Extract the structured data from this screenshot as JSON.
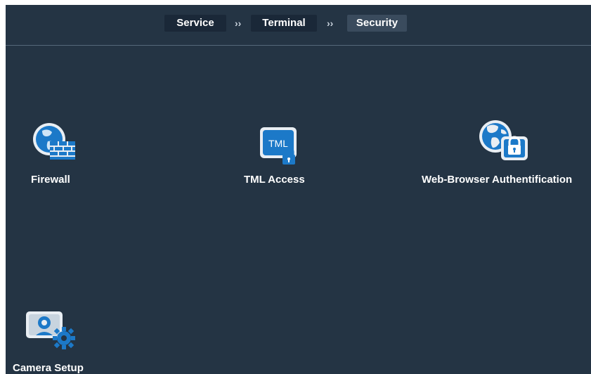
{
  "breadcrumb": {
    "items": [
      {
        "label": "Service"
      },
      {
        "label": "Terminal"
      },
      {
        "label": "Security"
      }
    ],
    "separator": "››",
    "active_index": 2
  },
  "tiles": [
    {
      "label": "Firewall",
      "icon": "firewall-icon"
    },
    {
      "label": "TML Access",
      "icon": "tml-lock-icon",
      "icon_text": "TML"
    },
    {
      "label": "Web-Browser Authentification",
      "icon": "globe-lock-icon"
    },
    {
      "label": "Camera Setup",
      "icon": "camera-gear-icon"
    }
  ],
  "colors": {
    "background": "#243444",
    "crumb_dark": "#1a2838",
    "crumb_active": "#3a4b5d",
    "icon_blue": "#1c79c8",
    "text": "#ffffff"
  }
}
